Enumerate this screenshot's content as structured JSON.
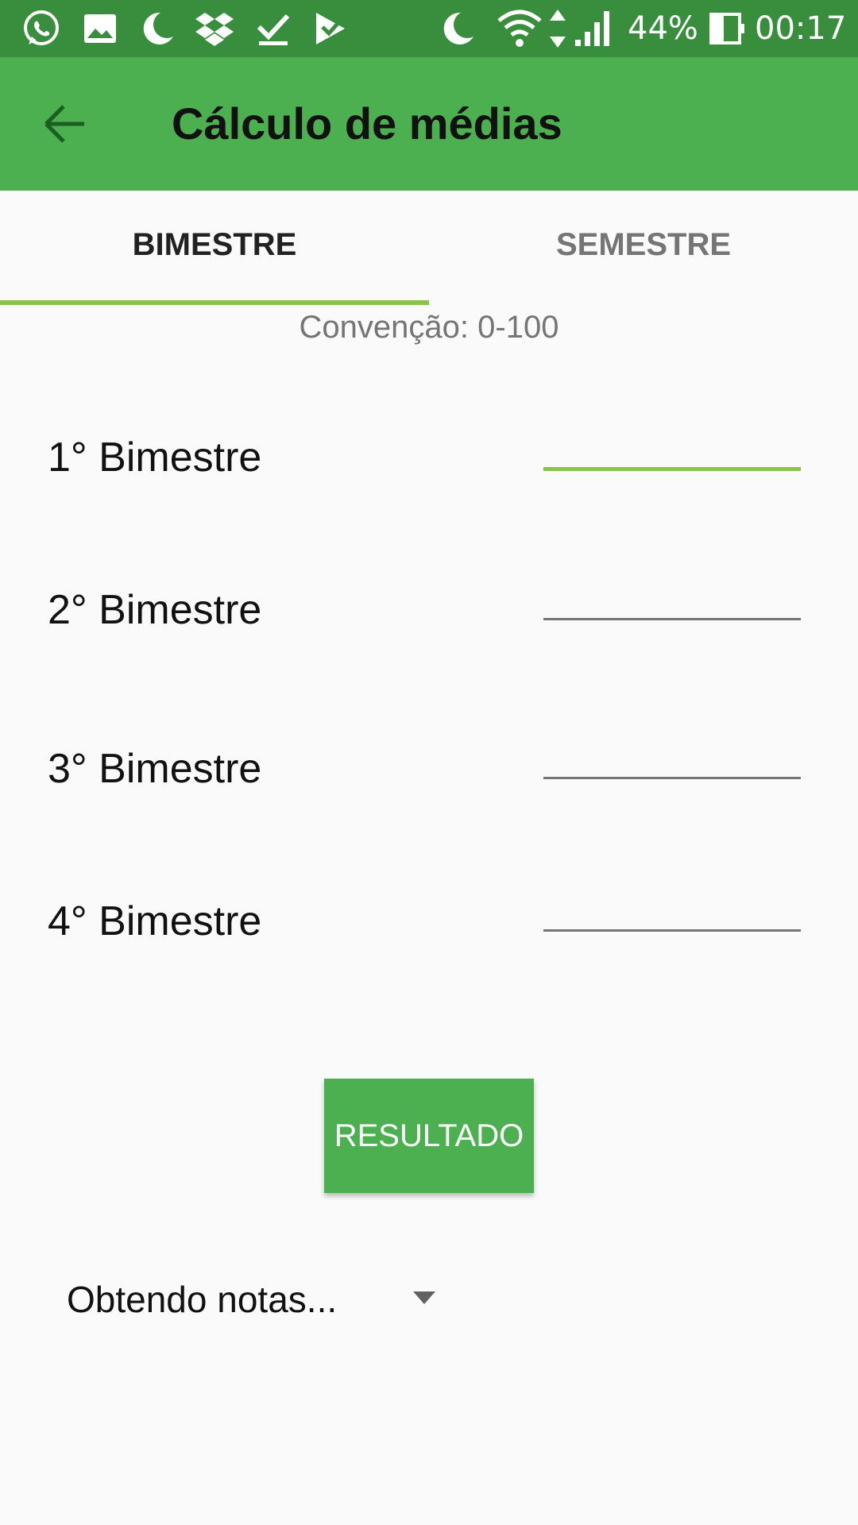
{
  "status_bar": {
    "left_icons": [
      "whatsapp-icon",
      "image-icon",
      "moon-icon",
      "dropbox-icon",
      "download-done-icon",
      "checklist-icon"
    ],
    "right_icons": [
      "moon-icon",
      "wifi-icon",
      "signal-icon",
      "battery-icon"
    ],
    "battery_percent": "44%",
    "time": "00:17"
  },
  "app_bar": {
    "title": "Cálculo de médias",
    "back_icon": "arrow-back-icon"
  },
  "tabs": [
    {
      "label": "BIMESTRE",
      "active": true
    },
    {
      "label": "SEMESTRE",
      "active": false
    }
  ],
  "convention": "Convenção: 0-100",
  "rows": [
    {
      "label": "1° Bimestre",
      "value": "",
      "focused": true
    },
    {
      "label": "2° Bimestre",
      "value": "",
      "focused": false
    },
    {
      "label": "3° Bimestre",
      "value": "",
      "focused": false
    },
    {
      "label": "4° Bimestre",
      "value": "",
      "focused": false
    }
  ],
  "result_button": "RESULTADO",
  "spinner": {
    "selected": "Obtendo notas...",
    "icon": "dropdown-arrow-icon"
  },
  "colors": {
    "status_bar": "#388e3c",
    "app_bar": "#4caf50",
    "accent": "#8bc34a",
    "button": "#4caf50",
    "background": "#fafafa"
  }
}
